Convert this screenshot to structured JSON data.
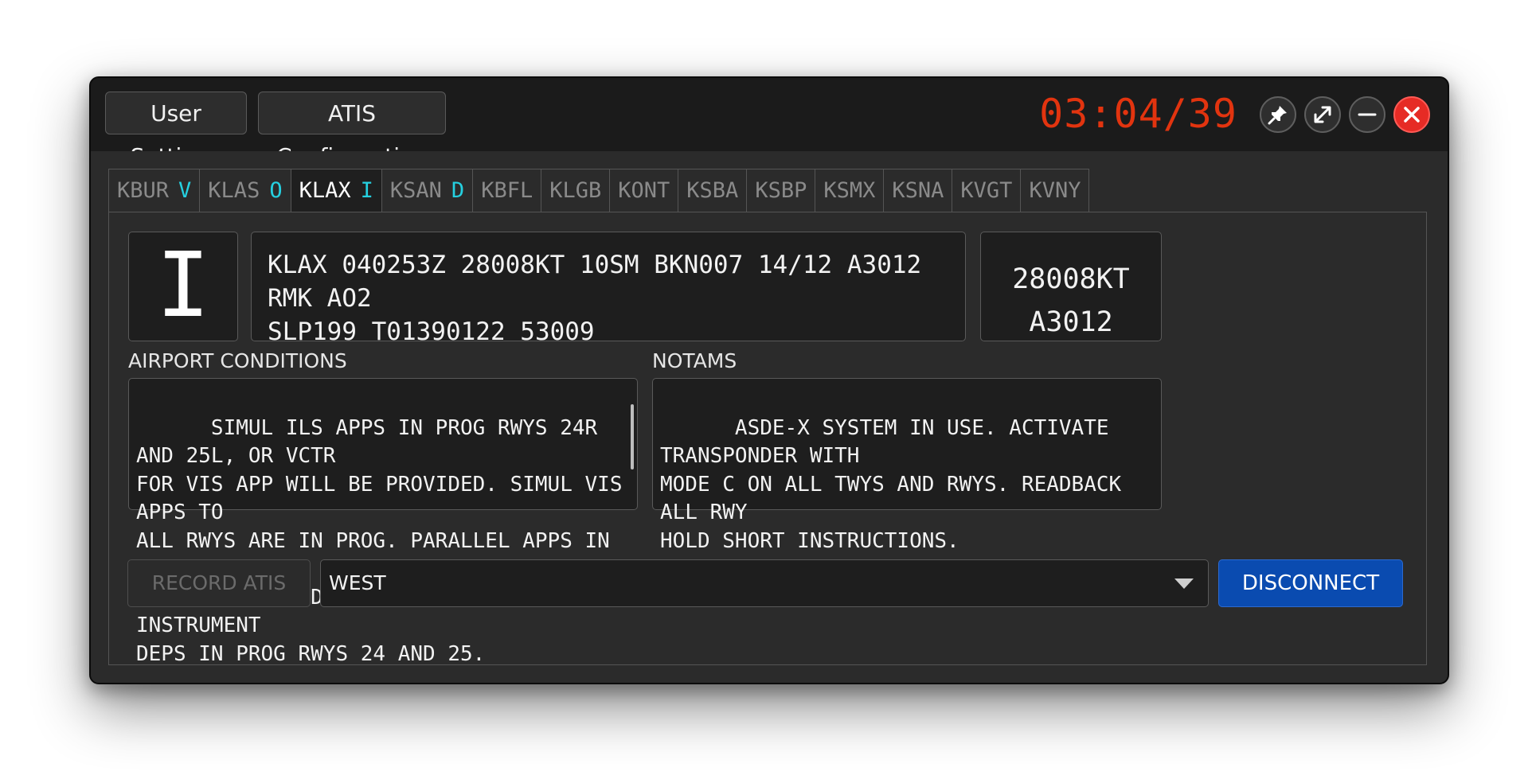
{
  "titlebar": {
    "user_settings": "User Settings",
    "atis_configuration": "ATIS Configuration",
    "clock": "03:04/39"
  },
  "tabs": [
    {
      "id": "KBUR",
      "status": "V",
      "active": false
    },
    {
      "id": "KLAS",
      "status": "O",
      "active": false
    },
    {
      "id": "KLAX",
      "status": "I",
      "active": true
    },
    {
      "id": "KSAN",
      "status": "D",
      "active": false
    },
    {
      "id": "KBFL",
      "status": "",
      "active": false
    },
    {
      "id": "KLGB",
      "status": "",
      "active": false
    },
    {
      "id": "KONT",
      "status": "",
      "active": false
    },
    {
      "id": "KSBA",
      "status": "",
      "active": false
    },
    {
      "id": "KSBP",
      "status": "",
      "active": false
    },
    {
      "id": "KSMX",
      "status": "",
      "active": false
    },
    {
      "id": "KSNA",
      "status": "",
      "active": false
    },
    {
      "id": "KVGT",
      "status": "",
      "active": false
    },
    {
      "id": "KVNY",
      "status": "",
      "active": false
    }
  ],
  "atis": {
    "letter": "I",
    "metar": "KLAX 040253Z 28008KT 10SM BKN007 14/12 A3012 RMK AO2\nSLP199 T01390122 53009",
    "wind": "28008KT",
    "altimeter": "A3012"
  },
  "airport_conditions": {
    "label": "AIRPORT CONDITIONS",
    "text": "SIMUL ILS APPS IN PROG RWYS 24R AND 25L, OR VCTR\nFOR VIS APP WILL BE PROVIDED. SIMUL VIS APPS TO\nALL RWYS ARE IN PROG. PARALLEL APPS IN PROG BTWN\nLOS ANGELES AND HAWTHORNE ARPTS. SIMUL INSTRUMENT\nDEPS IN PROG RWYS 24 AND 25."
  },
  "notams": {
    "label": "NOTAMS",
    "text": "ASDE-X SYSTEM IN USE. ACTIVATE TRANSPONDER WITH\nMODE C ON ALL TWYS AND RWYS. READBACK ALL RWY\nHOLD SHORT INSTRUCTIONS."
  },
  "footer": {
    "record_label": "RECORD ATIS",
    "preset_value": "WEST",
    "disconnect_label": "DISCONNECT"
  },
  "colors": {
    "clock": "#e2340f",
    "status_letter": "#25d0e0",
    "disconnect": "#0a4bb0",
    "close": "#e62b25"
  },
  "icons": [
    "pin-icon",
    "expand-icon",
    "minimize-icon",
    "close-icon"
  ]
}
